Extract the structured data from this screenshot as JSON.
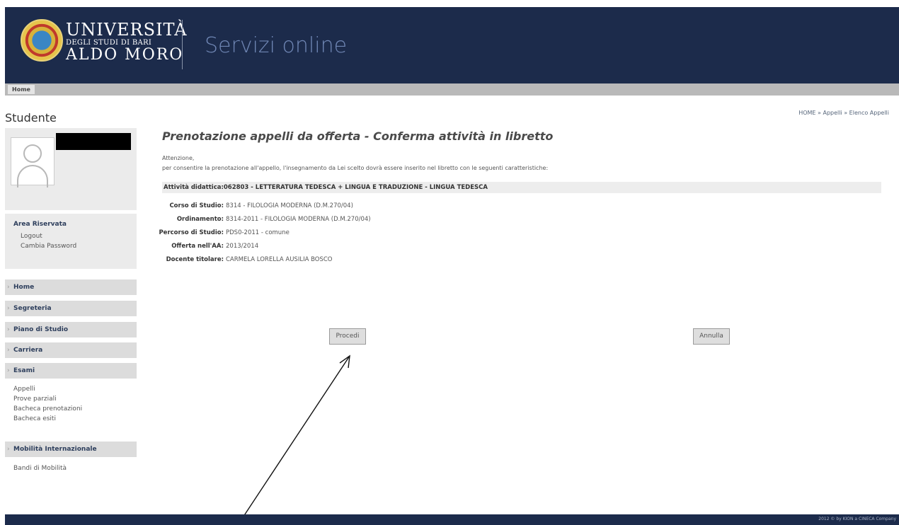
{
  "header": {
    "university_line1": "UNIVERSITÀ",
    "university_line2": "DEGLI STUDI DI BARI",
    "university_line3": "ALDO MORO",
    "site_title": "Servizi online"
  },
  "topnav": {
    "home_tab": "Home"
  },
  "sidebar": {
    "title": "Studente",
    "area_title": "Area Riservata",
    "area_links": [
      "Logout",
      "Cambia Password"
    ],
    "menu": [
      "Home",
      "Segreteria",
      "Piano di Studio",
      "Carriera",
      "Esami"
    ],
    "esami_links": [
      "Appelli",
      "Prove parziali",
      "Bacheca prenotazioni",
      "Bacheca esiti"
    ],
    "mobility": "Mobilità Internazionale",
    "mobility_links": [
      "Bandi di Mobilità"
    ]
  },
  "breadcrumb": "HOME » Appelli » Elenco Appelli",
  "main": {
    "title": "Prenotazione appelli da offerta - Conferma attività in libretto",
    "attention": "Attenzione,",
    "message": "per consentire la prenotazione all'appello, l'insegnamento da Lei scelto dovrà  essere inserito nel libretto con le seguenti caratteristiche:",
    "activity": "Attività didattica:062803 - LETTERATURA TEDESCA + LINGUA E TRADUZIONE - LINGUA TEDESCA",
    "details": [
      {
        "label": "Corso di Studio:",
        "value": "8314 - FILOLOGIA MODERNA (D.M.270/04)"
      },
      {
        "label": "Ordinamento:",
        "value": "8314-2011 - FILOLOGIA MODERNA (D.M.270/04)"
      },
      {
        "label": "Percorso di Studio:",
        "value": "PDS0-2011 - comune"
      },
      {
        "label": "Offerta nell'AA:",
        "value": "2013/2014"
      },
      {
        "label": "Docente titolare:",
        "value": "CARMELA LORELLA AUSILIA BOSCO"
      }
    ],
    "proceed_label": "Procedi",
    "cancel_label": "Annulla"
  },
  "footer": {
    "text": "2012 © by KION a CINECA Company"
  }
}
